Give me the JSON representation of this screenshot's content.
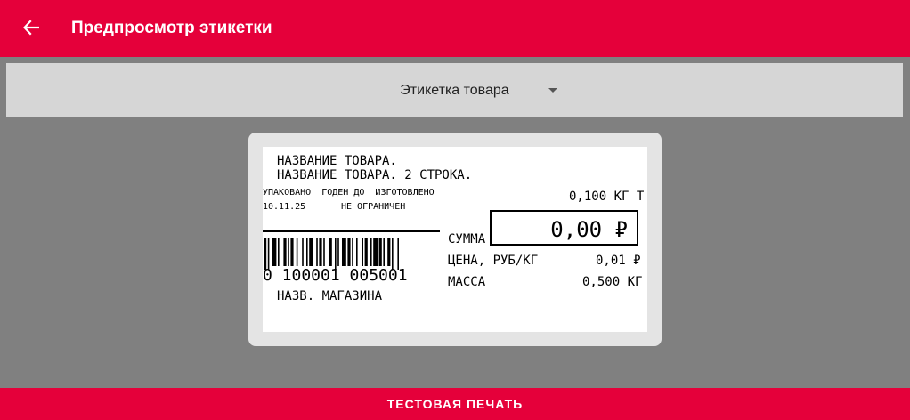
{
  "appbar": {
    "title": "Предпросмотр этикетки"
  },
  "selector": {
    "value": "Этикетка товара"
  },
  "label": {
    "product_name_line1": "НАЗВАНИЕ ТОВАРА.",
    "product_name_line2": "НАЗВАНИЕ ТОВАРА. 2 СТРОКА.",
    "header_row": "УПАКОВАНО  ГОДЕН ДО  ИЗГОТОВЛЕНО",
    "packed_date": "10.11.25",
    "expiry": "НЕ ОГРАНИЧЕН",
    "tare": "0,100 КГ Т",
    "sum_label": "СУММА",
    "sum_value": "0,00 ₽",
    "price_label": "ЦЕНА, РУБ/КГ",
    "price_value": "0,01 ₽",
    "mass_label": "МАССА",
    "mass_value": "0,500 КГ",
    "barcode_number": "0 100001 005001",
    "shop_name": "НАЗВ. МАГАЗИНА"
  },
  "footer": {
    "test_print_label": "ТЕСТОВАЯ ПЕЧАТЬ"
  },
  "colors": {
    "accent": "#e5003a",
    "background": "#808080",
    "selector": "#d6d6d6"
  },
  "icons": {
    "back": "arrow-left-icon",
    "dropdown": "caret-down-icon"
  }
}
